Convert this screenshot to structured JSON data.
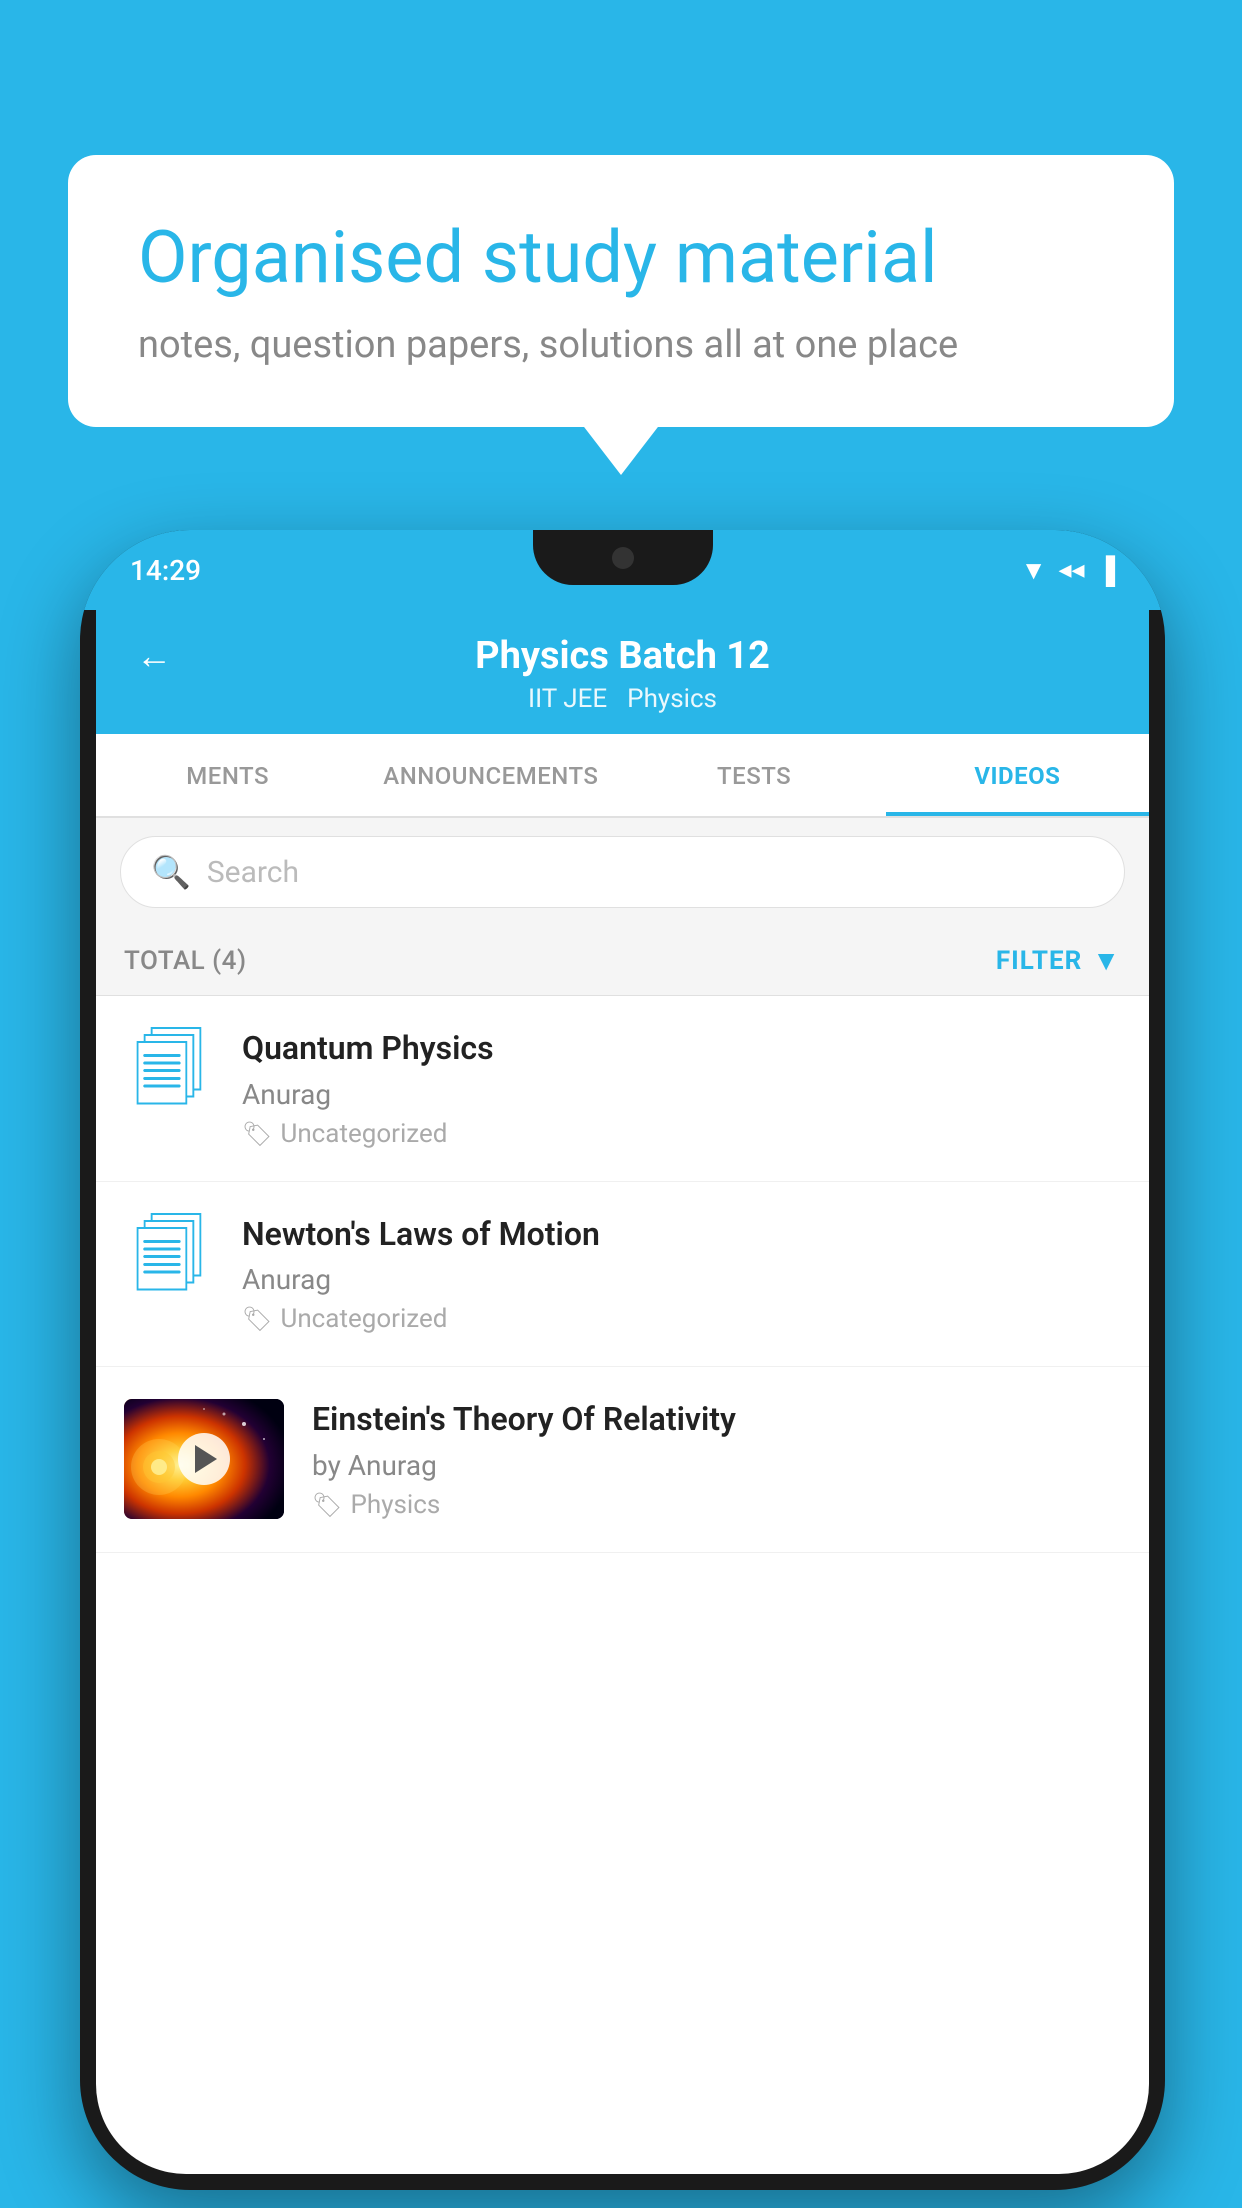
{
  "background_color": "#29b6e8",
  "speech_bubble": {
    "title": "Organised study material",
    "subtitle": "notes, question papers, solutions all at one place"
  },
  "phone": {
    "status_bar": {
      "time": "14:29",
      "icons": [
        "wifi",
        "signal",
        "battery"
      ]
    },
    "header": {
      "back_label": "←",
      "title": "Physics Batch 12",
      "subtitle_left": "IIT JEE",
      "subtitle_right": "Physics"
    },
    "tabs": [
      {
        "label": "MENTS",
        "active": false
      },
      {
        "label": "ANNOUNCEMENTS",
        "active": false
      },
      {
        "label": "TESTS",
        "active": false
      },
      {
        "label": "VIDEOS",
        "active": true
      }
    ],
    "search": {
      "placeholder": "Search"
    },
    "filter_bar": {
      "total_label": "TOTAL (4)",
      "filter_label": "FILTER"
    },
    "videos": [
      {
        "id": 1,
        "title": "Quantum Physics",
        "author": "Anurag",
        "tag": "Uncategorized",
        "type": "folder",
        "has_thumb": false
      },
      {
        "id": 2,
        "title": "Newton's Laws of Motion",
        "author": "Anurag",
        "tag": "Uncategorized",
        "type": "folder",
        "has_thumb": false
      },
      {
        "id": 3,
        "title": "Einstein's Theory Of Relativity",
        "author": "by Anurag",
        "tag": "Physics",
        "type": "video",
        "has_thumb": true
      }
    ]
  }
}
